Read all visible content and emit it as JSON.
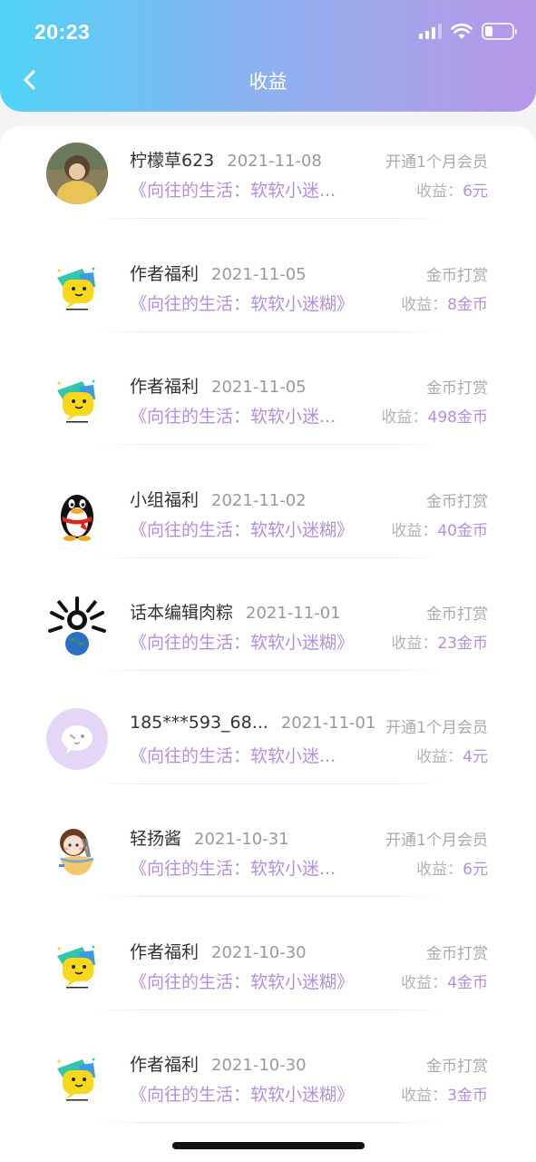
{
  "status_bar": {
    "time": "20:23",
    "battery_level": 0.3
  },
  "header": {
    "title": "收益"
  },
  "income_label": "收益：",
  "records": [
    {
      "name": "柠檬草623",
      "date": "2021-11-08",
      "type": "开通1个月会员",
      "book": "《向往的生活：软软小迷...",
      "amount": "6元",
      "avatar": "photo-avatar"
    },
    {
      "name": "作者福利",
      "date": "2021-11-05",
      "type": "金币打赏",
      "book": "《向往的生活：软软小迷糊》",
      "amount": "8金币",
      "avatar": "speech-bubble-avatar"
    },
    {
      "name": "作者福利",
      "date": "2021-11-05",
      "type": "金币打赏",
      "book": "《向往的生活：软软小迷...",
      "amount": "498金币",
      "avatar": "speech-bubble-avatar"
    },
    {
      "name": "小组福利",
      "date": "2021-11-02",
      "type": "金币打赏",
      "book": "《向往的生活：软软小迷糊》",
      "amount": "40金币",
      "avatar": "penguin-avatar"
    },
    {
      "name": "话本编辑肉粽",
      "date": "2021-11-01",
      "type": "金币打赏",
      "book": "《向往的生活：软软小迷糊》",
      "amount": "23金币",
      "avatar": "globe-avatar"
    },
    {
      "name": "185***593_68...",
      "date": "2021-11-01",
      "type": "开通1个月会员",
      "book": "《向往的生活：软软小迷...",
      "amount": "4元",
      "avatar": "default-avatar"
    },
    {
      "name": "轻扬酱",
      "date": "2021-10-31",
      "type": "开通1个月会员",
      "book": "《向往的生活：软软小迷...",
      "amount": "6元",
      "avatar": "girl-avatar"
    },
    {
      "name": "作者福利",
      "date": "2021-10-30",
      "type": "金币打赏",
      "book": "《向往的生活：软软小迷糊》",
      "amount": "4金币",
      "avatar": "speech-bubble-avatar"
    },
    {
      "name": "作者福利",
      "date": "2021-10-30",
      "type": "金币打赏",
      "book": "《向往的生活：软软小迷糊》",
      "amount": "3金币",
      "avatar": "speech-bubble-avatar"
    }
  ],
  "colors": {
    "accent": "#b48fe0",
    "header_start": "#4fd3f7",
    "header_end": "#b797e9"
  }
}
